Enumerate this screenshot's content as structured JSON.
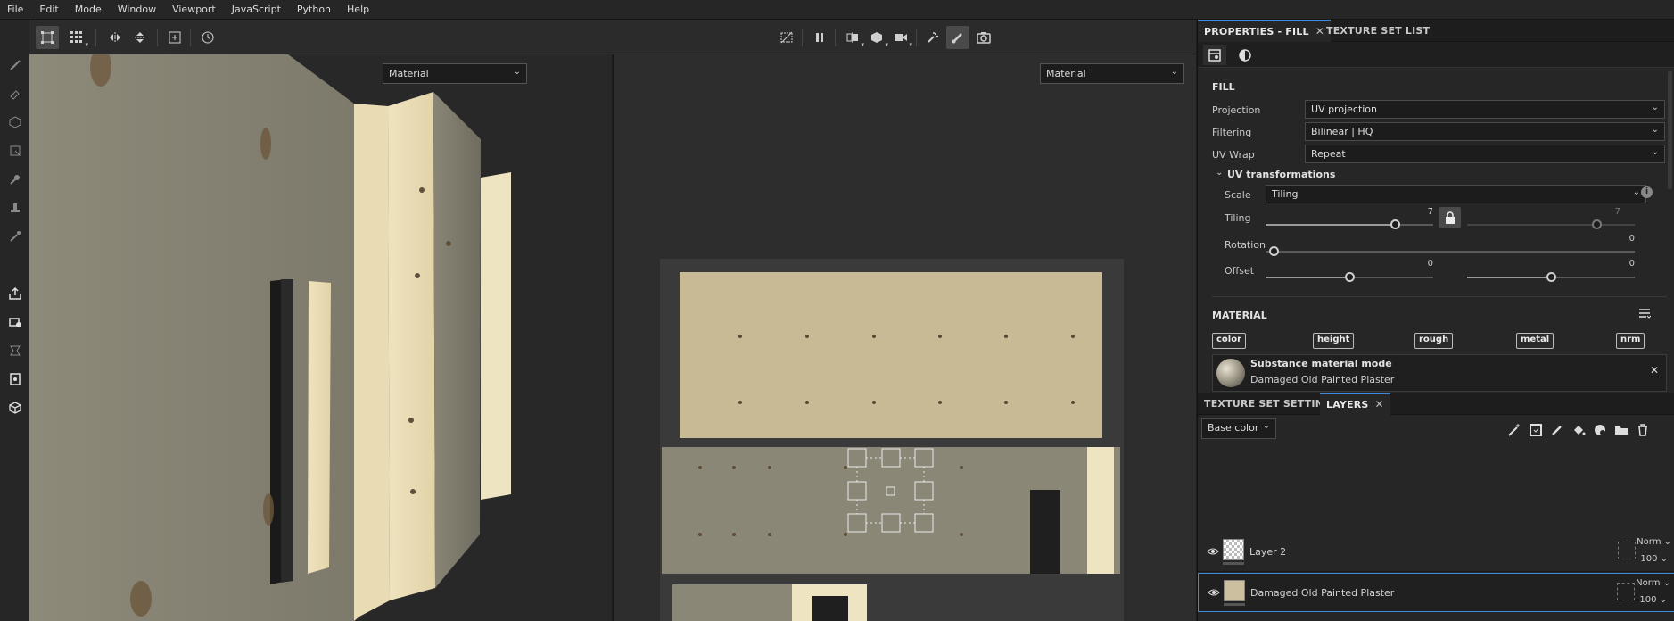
{
  "menu": [
    "File",
    "Edit",
    "Mode",
    "Window",
    "Viewport",
    "JavaScript",
    "Python",
    "Help"
  ],
  "viewport3d": {
    "mode": "Material"
  },
  "viewport2d": {
    "mode": "Material"
  },
  "properties": {
    "tab_active": "PROPERTIES - FILL",
    "tab_other": "TEXTURE SET LIST",
    "fill_heading": "FILL",
    "projection": {
      "label": "Projection",
      "value": "UV projection"
    },
    "filtering": {
      "label": "Filtering",
      "value": "Bilinear | HQ"
    },
    "uvwrap": {
      "label": "UV Wrap",
      "value": "Repeat"
    },
    "uvtrans": {
      "heading": "UV transformations",
      "scale_label": "Scale",
      "scale_value": "Tiling",
      "tiling_label": "Tiling",
      "tiling_u": "7",
      "tiling_v": "7",
      "rotation_label": "Rotation",
      "rotation_value": "0",
      "offset_label": "Offset",
      "offset_u": "0",
      "offset_v": "0"
    },
    "material": {
      "heading": "MATERIAL",
      "channels": [
        "color",
        "height",
        "rough",
        "metal",
        "nrm"
      ],
      "mode_title": "Substance material mode",
      "mode_name": "Damaged Old Painted Plaster"
    }
  },
  "layers_panel": {
    "tab_other": "TEXTURE SET SETTINGS",
    "tab_active": "LAYERS",
    "channel_select": "Base color",
    "layers": [
      {
        "name": "Layer 2",
        "blend": "Norm",
        "opacity": "100"
      },
      {
        "name": "Damaged Old Painted Plaster",
        "blend": "Norm",
        "opacity": "100"
      }
    ]
  },
  "colors": {
    "accent": "#3d8be0",
    "plaster_light": "#efe3bf",
    "plaster_gray": "#8a8778"
  }
}
